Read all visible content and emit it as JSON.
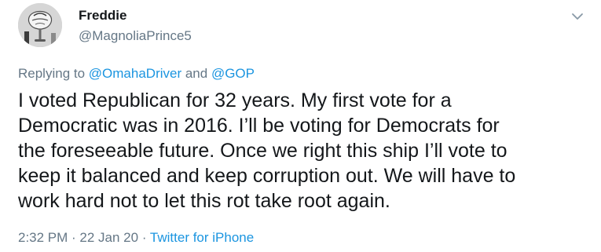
{
  "tweet": {
    "display_name": "Freddie",
    "handle": "@MagnoliaPrince5",
    "reply": {
      "prefix": "Replying to ",
      "user1": "@OmahaDriver",
      "conjunction": " and ",
      "user2": "@GOP"
    },
    "text": "I voted Republican for 32 years. My first vote for a\nDemocratic was in 2016. I’ll be voting for Democrats for\nthe foreseeable future. Once we right this ship I’ll vote to\nkeep it balanced and keep corruption out. We will have to\nwork hard not to let this rot take root again.",
    "time": "2:32 PM",
    "separator": " · ",
    "date": "22 Jan 20",
    "source": "Twitter for iPhone"
  },
  "icons": {
    "avatar": "profile-photo",
    "menu": "chevron-down-icon"
  },
  "colors": {
    "text": "#14171a",
    "secondary": "#657786",
    "link": "#1b95e0",
    "background": "#ffffff"
  }
}
